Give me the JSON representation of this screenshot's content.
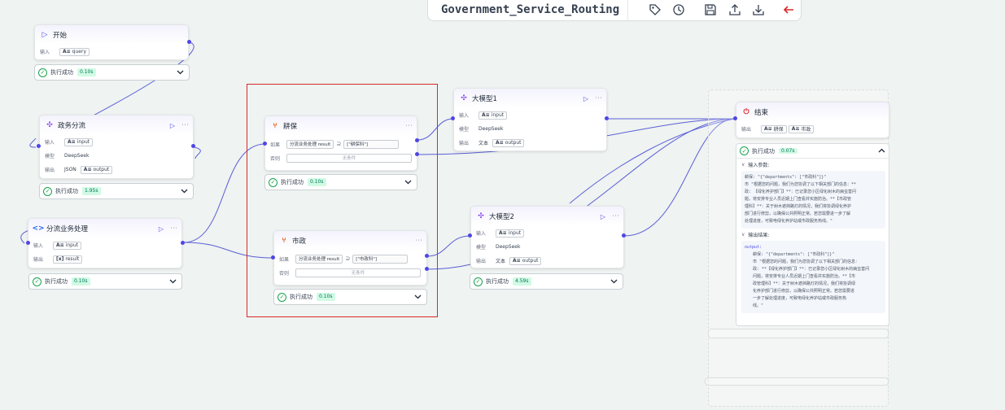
{
  "toolbar": {
    "title": "Government_Service_Routing",
    "buttons": [
      "tag-icon",
      "history-icon",
      "save-icon",
      "upload-icon",
      "download-icon",
      "back-arrow-icon"
    ]
  },
  "labels": {
    "input": "输入",
    "output": "输出",
    "model": "模型",
    "text": "文本",
    "if": "如果",
    "else": "否则",
    "no_condition": "无条件",
    "run_success": "执行成功"
  },
  "nodes": {
    "start": {
      "title": "开始",
      "input_var": "query",
      "time": "0.10s"
    },
    "gov_split": {
      "title": "政务分流",
      "input_var": "input",
      "model": "DeepSeek",
      "output_type": "JSON",
      "output_var": "output",
      "time": "1.95s"
    },
    "split_proc": {
      "title": "分流业务处理",
      "input_var": "input",
      "output_var": "result",
      "time": "0.10s"
    },
    "gengbao": {
      "title": "耕保",
      "cond_left": "分流业务处理 result",
      "cond_op": "⊇",
      "cond_right": "[\"耕保科\"]",
      "time": "0.10s"
    },
    "shizheng": {
      "title": "市政",
      "cond_left": "分流业务处理 result",
      "cond_op": "⊇",
      "cond_right": "[\"市政科\"]",
      "time": "0.10s"
    },
    "llm1": {
      "title": "大模型1",
      "input_var": "input",
      "model": "DeepSeek",
      "output_var": "output"
    },
    "llm2": {
      "title": "大模型2",
      "input_var": "input",
      "model": "DeepSeek",
      "output_var": "output",
      "time": "4.59s"
    },
    "end": {
      "title": "结束",
      "out1": "耕保",
      "out2": "市政"
    }
  },
  "panel": {
    "status": "执行成功",
    "time": "0.07s",
    "input_section": "输入参数:",
    "output_section": "输出结果:",
    "input_lines": [
      "耕保: \"{\"departments\": [\"市政科\"]}\"",
      "市  \"根据您的问题，我们为您协调了以下相关部门的信息：**",
      "政: 【绿化养护部门】**：已记录您小区绿化树木的病虫害问",
      "    题，将安排专业人员近期上门查看并实施防治。**【市政管",
      "    理科】**：关于树木遮挡路灯的情况，我们将协调绿化养护",
      "    部门进行修剪，以确保公共照明正常。若您需要进一步了解",
      "    处理进度，可致电绿化养护站或市政服务热线。\""
    ],
    "output_key": "output:",
    "output_lines": [
      "耕保: \"{\"departments\": [\"市政科\"]}\"",
      "市  \"根据您的问题，我们为您协调了以下相关部门的信息：",
      "政: **【绿化养护部门】**：已记录您小区绿化树木的病虫害问",
      "    问题，将安排专业人员近期上门查看并实施防治。**【市",
      "    政管理科】**：关于树木遮挡路灯的情况，我们将协调绿",
      "    化养护部门进行修剪，以确保公共照明正常。若您需要进",
      "    一步了解处理进度，可致电绿化养护站或市政服务热",
      "    线。\""
    ]
  }
}
